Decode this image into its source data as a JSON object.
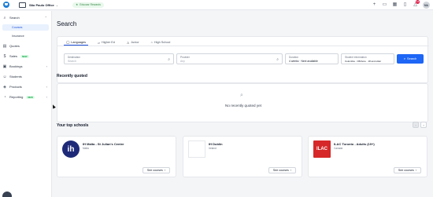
{
  "topbar": {
    "office": "São Paulo Office",
    "rewards": "Educasr Rewards",
    "notif_count": "13",
    "avatar_initials": "MA"
  },
  "sidebar": {
    "search": "Search",
    "courses": "Courses",
    "insurance": "Insurance",
    "quotes": "Quotes",
    "sales": "Sales",
    "sales_badge": "NEW",
    "bookings": "Bookings",
    "students": "Students",
    "products": "Products",
    "reporting": "Reporting",
    "reporting_badge": "NEW"
  },
  "main": {
    "title": "Search",
    "tabs": [
      "Languages",
      "Higher Ed",
      "Junior",
      "High School"
    ],
    "fields": {
      "destination_label": "Destination",
      "destination_placeholder": "Search",
      "provider_label": "Provider",
      "provider_placeholder": "Any",
      "duration_label": "Duration",
      "duration_value": "4 weeks · Next available",
      "student_label": "Student information",
      "student_value": "Colombia · Offshore · 18 and older"
    },
    "search_button": "Search",
    "recent_title": "Recently quoted",
    "recent_empty": "No recently quoted yet",
    "schools_title": "Your top schools",
    "see_courses": "See courses",
    "schools": [
      {
        "name": "IH Malta - St Julian's Centre",
        "city": "Malta",
        "logo": "ih"
      },
      {
        "name": "IH Dublin",
        "city": "Ireland",
        "logo": ""
      },
      {
        "name": "ILAC Toronto - Adults (19+)",
        "city": "Canada",
        "logo": "ILAC"
      }
    ]
  },
  "colors": {
    "accent": "#1e66f5",
    "active_bg": "#e8f1fd",
    "new_badge": "#16a34a"
  }
}
